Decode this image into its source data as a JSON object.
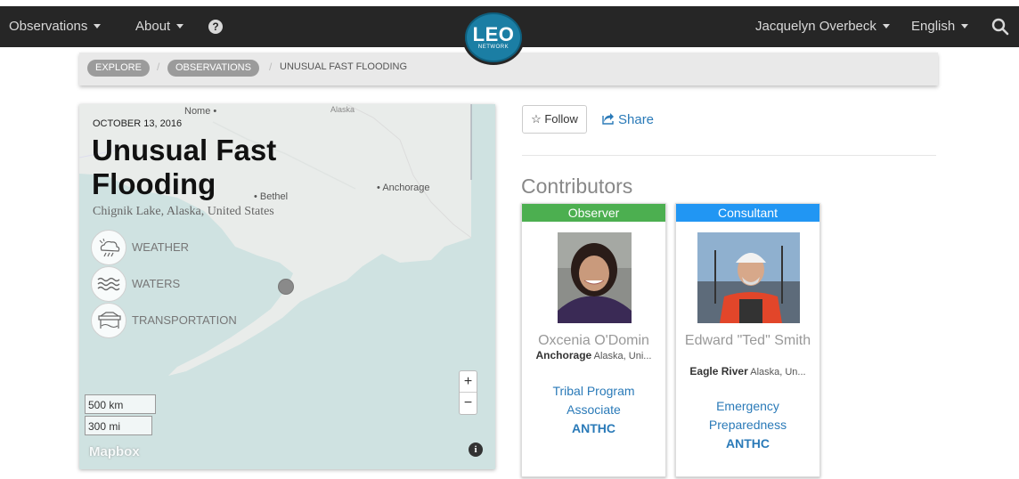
{
  "nav": {
    "observations": "Observations",
    "about": "About",
    "help": "?",
    "user": "Jacquelyn Overbeck",
    "language": "English",
    "logo_main": "LEO",
    "logo_sub": "NETWORK"
  },
  "breadcrumb": {
    "explore": "EXPLORE",
    "observations": "OBSERVATIONS",
    "current": "UNUSUAL FAST FLOODING",
    "separator": "/"
  },
  "observation": {
    "date": "OCTOBER 13, 2016",
    "title": "Unusual Fast Flooding",
    "location": "Chignik Lake, Alaska, United States",
    "tags": [
      {
        "label": "WEATHER",
        "icon": "weather-icon"
      },
      {
        "label": "WATERS",
        "icon": "waters-icon"
      },
      {
        "label": "TRANSPORTATION",
        "icon": "transportation-icon"
      }
    ]
  },
  "map": {
    "places": {
      "nome": "Nome",
      "alaska": "Alaska",
      "bethel": "Bethel",
      "anchorage": "Anchorage"
    },
    "zoom_in": "+",
    "zoom_out": "−",
    "scale_km": "500 km",
    "scale_mi": "300 mi",
    "attribution": "Mapbox",
    "info": "i"
  },
  "actions": {
    "follow": "Follow",
    "share": "Share"
  },
  "contributors": {
    "heading": "Contributors",
    "cards": [
      {
        "role": "Observer",
        "role_color": "#4caf50",
        "name": "Oxcenia O'Domin",
        "city": "Anchorage",
        "region": "Alaska, Uni...",
        "job": "Tribal Program Associate",
        "org": "ANTHC"
      },
      {
        "role": "Consultant",
        "role_color": "#2196f3",
        "name": "Edward \"Ted\" Smith",
        "city": "Eagle River",
        "region": "Alaska, Un...",
        "job": "Emergency Preparedness",
        "org": "ANTHC"
      }
    ]
  }
}
